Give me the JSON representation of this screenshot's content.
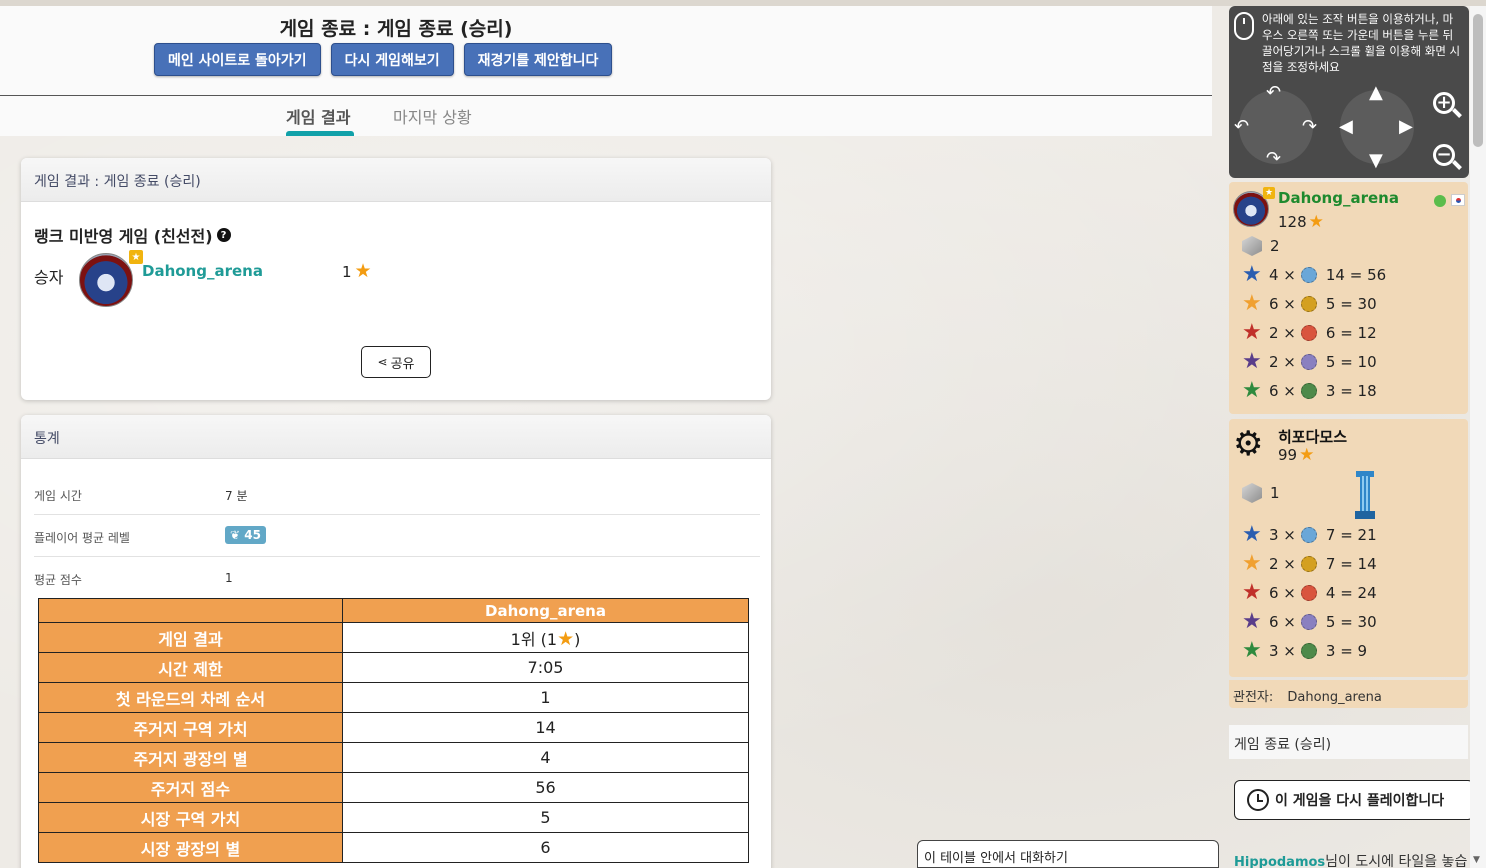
{
  "header": {
    "title": "게임 종료 : 게임 종료 (승리)",
    "buttons": [
      "메인 사이트로 돌아가기",
      "다시 게임해보기",
      "재경기를 제안합니다"
    ]
  },
  "tabs": [
    "게임 결과",
    "마지막 상황"
  ],
  "result_panel": {
    "title": "게임 결과 : 게임 종료 (승리)",
    "rank_text": "랭크 미반영 게임 (친선전)",
    "winner_label": "승자",
    "winner_name": "Dahong_arena",
    "winner_score": "1",
    "share_label": "공유"
  },
  "stats_panel": {
    "title": "통계",
    "rows": [
      {
        "key": "게임 시간",
        "value": "7 분"
      },
      {
        "key": "플레이어 평균 레벨",
        "value": "45"
      },
      {
        "key": "평균 점수",
        "value": "1"
      }
    ]
  },
  "results_table": {
    "player": "Dahong_arena",
    "rows": [
      {
        "label": "게임 결과",
        "value": "1위 (1⭐)"
      },
      {
        "label": "시간 제한",
        "value": "7:05"
      },
      {
        "label": "첫 라운드의 차례 순서",
        "value": "1"
      },
      {
        "label": "주거지 구역 가치",
        "value": "14"
      },
      {
        "label": "주거지 광장의 별",
        "value": "4"
      },
      {
        "label": "주거지 점수",
        "value": "56"
      },
      {
        "label": "시장 구역 가치",
        "value": "5"
      },
      {
        "label": "시장 광장의 별",
        "value": "6"
      }
    ]
  },
  "controls": {
    "help_text": "아래에 있는 조작 버튼을 이용하거나, 마우스 오른쪽 또는 가운데 버튼을 누른 뒤 끌어당기거나 스크롤 휠을 이용해 화면 시점을 조정하세요"
  },
  "players": [
    {
      "name": "Dahong_arena",
      "name_color": "#1e8a2e",
      "score": "128",
      "cubes": "2",
      "rows": [
        {
          "star_color": "#2a5db0",
          "gem_color": "#6aa7d8",
          "mult": "4 ×",
          "rest": "14 = 56"
        },
        {
          "star_color": "#f0a030",
          "gem_color": "#d4a020",
          "mult": "6 ×",
          "rest": "5 = 30"
        },
        {
          "star_color": "#c0302a",
          "gem_color": "#d9553e",
          "mult": "2 ×",
          "rest": "6 = 12"
        },
        {
          "star_color": "#5a3d8a",
          "gem_color": "#8a80c0",
          "mult": "2 ×",
          "rest": "5 = 10"
        },
        {
          "star_color": "#2e8a3e",
          "gem_color": "#4e8a4a",
          "mult": "6 ×",
          "rest": "3 = 18"
        }
      ]
    },
    {
      "name": "히포다모스",
      "name_color": "#111111",
      "score": "99",
      "cubes": "1",
      "rows": [
        {
          "star_color": "#2a5db0",
          "gem_color": "#6aa7d8",
          "mult": "3 ×",
          "rest": "7 = 21"
        },
        {
          "star_color": "#f0a030",
          "gem_color": "#d4a020",
          "mult": "2 ×",
          "rest": "7 = 14"
        },
        {
          "star_color": "#c0302a",
          "gem_color": "#d9553e",
          "mult": "6 ×",
          "rest": "4 = 24"
        },
        {
          "star_color": "#5a3d8a",
          "gem_color": "#8a80c0",
          "mult": "6 ×",
          "rest": "5 = 30"
        },
        {
          "star_color": "#2e8a3e",
          "gem_color": "#4e8a4a",
          "mult": "3 ×",
          "rest": "3 = 9"
        }
      ]
    }
  ],
  "spectator": {
    "label": "관전자:",
    "name": "Dahong_arena"
  },
  "end_status": "게임 종료 (승리)",
  "replay_label": "이 게임을 다시 플레이합니다",
  "log": {
    "who": "Hippodamos",
    "text": "님이 도시에 타일을 놓습"
  },
  "chat_label": "이 테이블 안에서 대화하기"
}
